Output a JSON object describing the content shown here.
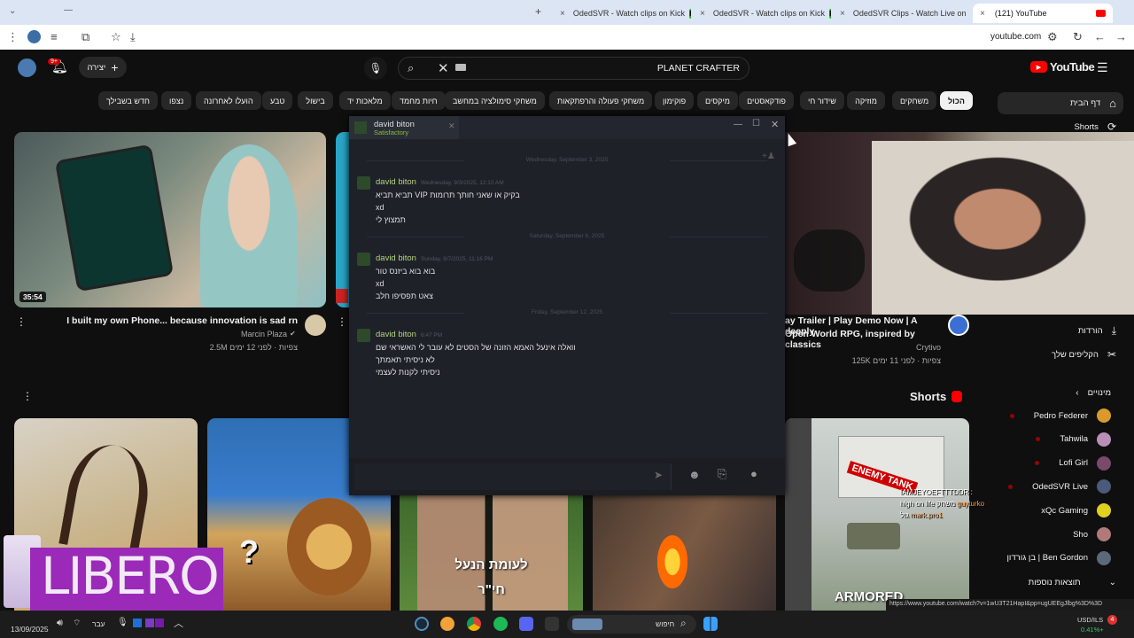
{
  "tabs": [
    {
      "label": "OdedSVR - Watch clips on Kick",
      "favicon": "kick"
    },
    {
      "label": "OdedSVR - Watch clips on Kick",
      "favicon": "kick"
    },
    {
      "label": "OdedSVR Clips - Watch Live on",
      "favicon": "kick"
    },
    {
      "label": "(121) YouTube",
      "favicon": "youtube"
    }
  ],
  "address": {
    "url": "youtube.com"
  },
  "header": {
    "logo": "YouTube",
    "search_value": "PLANET CRAFTER",
    "create_label": "יצירה",
    "notif_count": "9+"
  },
  "chips": [
    "הכול",
    "משחקים",
    "מוזיקה",
    "שידור חי",
    "פודקאסטים",
    "מיקסים",
    "פוקימון",
    "משחקי פעולה והרפתקאות",
    "משחקי סימולציה במחשב",
    "חיות מחמד",
    "מלאכות יד",
    "בישול",
    "טבע",
    "הועלו לאחרונה",
    "נצפו",
    "חדש בשבילך"
  ],
  "sidebar": {
    "home": "דף הבית",
    "shorts": "Shorts",
    "downloads": "הורדות",
    "clips": "הקליפים שלך",
    "subs_title": "מינויים",
    "subs": [
      "Pedro Federer",
      "Tahwila",
      "Lofi Girl",
      "OdedSVR Live",
      "xQc Gaming",
      "Sho",
      "בן גורדון | Ben Gordon"
    ],
    "more": "תוצאות נוספות"
  },
  "videos": [
    {
      "title": "I built my own Phone... because innovation is sad rn",
      "channel": "Marcin Plaza",
      "meta": "2.5M צפיות · לפני 12 ימים",
      "duration": "35:54"
    },
    {
      "title": "ay Trailer | Play Demo Now | A deeply",
      "title2": "Open World RPG, inspired by classics",
      "channel": "Crytivo",
      "meta": "125K צפיות · לפני 11 ימים"
    }
  ],
  "shorts_title": "Shorts",
  "shorts_overlays": [
    "לעומת הנעל",
    "חי\"ר",
    "ARMORED",
    "ENEMY TANK",
    "LIBERO"
  ],
  "chat": {
    "name": "david biton",
    "status": "Satisfactory",
    "blocks": [
      {
        "date": "Wednesday, September 3, 2025",
        "name": "david biton",
        "time": "Wednesday, 9/3/2025, 12:10 AM",
        "lines": [
          "בקיק או שאני חותך תרומות VIP תביא תביא",
          "xd",
          "תמצוץ לי"
        ]
      },
      {
        "date": "Saturday, September 6, 2025",
        "name": "david biton",
        "time": "Sunday, 9/7/2025, 11:16 PM",
        "lines": [
          "בוא בוא ביזנס טור",
          "xd",
          "צאט תפסיפו חלב"
        ]
      },
      {
        "date": "Friday, September 12, 2025",
        "name": "david biton",
        "time": "6:47 PM",
        "lines": [
          "וואלה אינעל האמא הזונה של הסטים לא עובר לי האשראי שם",
          "לא ניסיתי תאמתך",
          "ניסיתי לקנות לעצמי"
        ]
      }
    ]
  },
  "stream_chat": [
    {
      "user": "IAMJEYOEFTTTDDR",
      "text": ""
    },
    {
      "user": "guyturko",
      "text": "high on life משחק"
    },
    {
      "user": "mark.pro1",
      "text": "גול"
    }
  ],
  "status_url": "https://www.youtube.com/watch?v=1wU3T21HapI&pp=ugUEEgJlbg%3D%3D",
  "taskbar": {
    "date": "13/09/2025",
    "lang": "עבר",
    "search": "חיפוש",
    "currency": "USD/ILS",
    "currency_change": "0.41%+",
    "badge": "4"
  }
}
